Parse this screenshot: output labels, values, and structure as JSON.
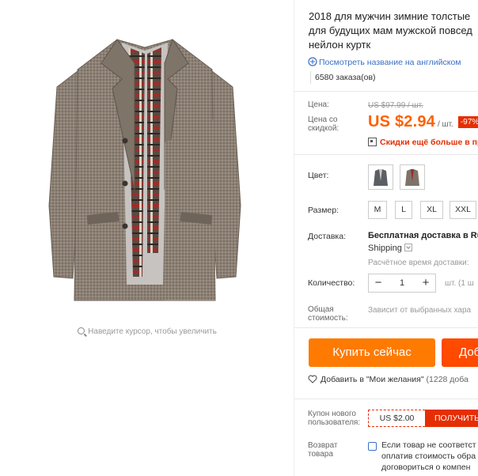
{
  "product": {
    "title": "2018 для мужчин зимние толстые\nдля будущих мам мужской повсед\nнейлон куртк",
    "english_link": "Посмотреть название на английском",
    "orders": "6580 заказа(ов)",
    "zoom_hint": "Наведите курсор, чтобы увеличить"
  },
  "price": {
    "label": "Цена:",
    "old": "US $97.99 / шт.",
    "discount_label": "Цена со скидкой:",
    "new": "US $2.94",
    "per": "/ шт.",
    "discount_badge": "-97%",
    "qr_text": "Скидки ещё больше в приложении"
  },
  "options": {
    "color_label": "Цвет:",
    "size_label": "Размер:",
    "sizes": [
      "M",
      "L",
      "XL",
      "XXL"
    ]
  },
  "shipping": {
    "label": "Доставка:",
    "line1": "Бесплатная доставка в Ru",
    "line2": "Shipping",
    "time": "Расчётное время доставки:"
  },
  "quantity": {
    "label": "Количество:",
    "minus": "−",
    "value": "1",
    "plus": "+",
    "unit": "шт. (1 ш"
  },
  "total": {
    "label": "Общая стоимость:",
    "value": "Зависит от выбранных хара"
  },
  "actions": {
    "buy": "Купить сейчас",
    "cart": "Доб",
    "wishlist": "Добавить в \"Мои желания\"",
    "wishlist_count": "(1228 доба"
  },
  "coupon": {
    "label": "Купон нового пользователя:",
    "amount": "US $2.00",
    "get": "ПОЛУЧИТЬ"
  },
  "returns": {
    "label": "Возврат товара",
    "text": "Если товар не соответст\nоплатив стоимость обра\nдоговориться о компен"
  },
  "colors": {
    "accent": "#ff6000",
    "buy": "#ff7a00",
    "cart": "#ff4a00",
    "red": "#e62e04",
    "link": "#3a6fc4"
  }
}
